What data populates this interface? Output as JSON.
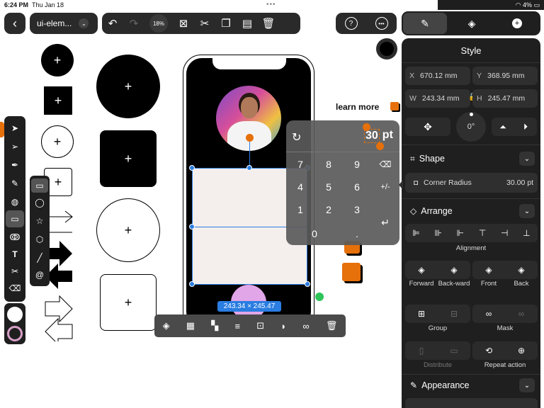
{
  "status": {
    "time": "6:24 PM",
    "date": "Thu Jan 18",
    "battery": "4%"
  },
  "toolbar": {
    "doc_title": "ui-elem...",
    "zoom": "18%"
  },
  "canvas": {
    "learn_more": "learn more",
    "size_badge": "243.34 × 245.47"
  },
  "keypad": {
    "value": "30",
    "unit": "pt",
    "keys": [
      "7",
      "8",
      "9",
      "4",
      "5",
      "6",
      "1",
      "2",
      "3",
      "0",
      "."
    ],
    "plusminus": "+/-"
  },
  "panel": {
    "title": "Style",
    "x_label": "X",
    "x_value": "670.12 mm",
    "y_label": "Y",
    "y_value": "368.95 mm",
    "w_label": "W",
    "w_value": "243.34 mm",
    "h_label": "H",
    "h_value": "245.47 mm",
    "rotation": "0°",
    "shape_title": "Shape",
    "corner_radius_label": "Corner Radius",
    "corner_radius_value": "30.00 pt",
    "arrange_title": "Arrange",
    "alignment_label": "Alignment",
    "forward": "Forward",
    "backward": "Back-ward",
    "front": "Front",
    "back": "Back",
    "group": "Group",
    "mask": "Mask",
    "distribute": "Distribute",
    "repeat_action": "Repeat action",
    "appearance_title": "Appearance"
  },
  "colors": {
    "accent_orange": "#e6700a",
    "selection_blue": "#2a7de1",
    "panel_bg": "#1f1f1f"
  }
}
